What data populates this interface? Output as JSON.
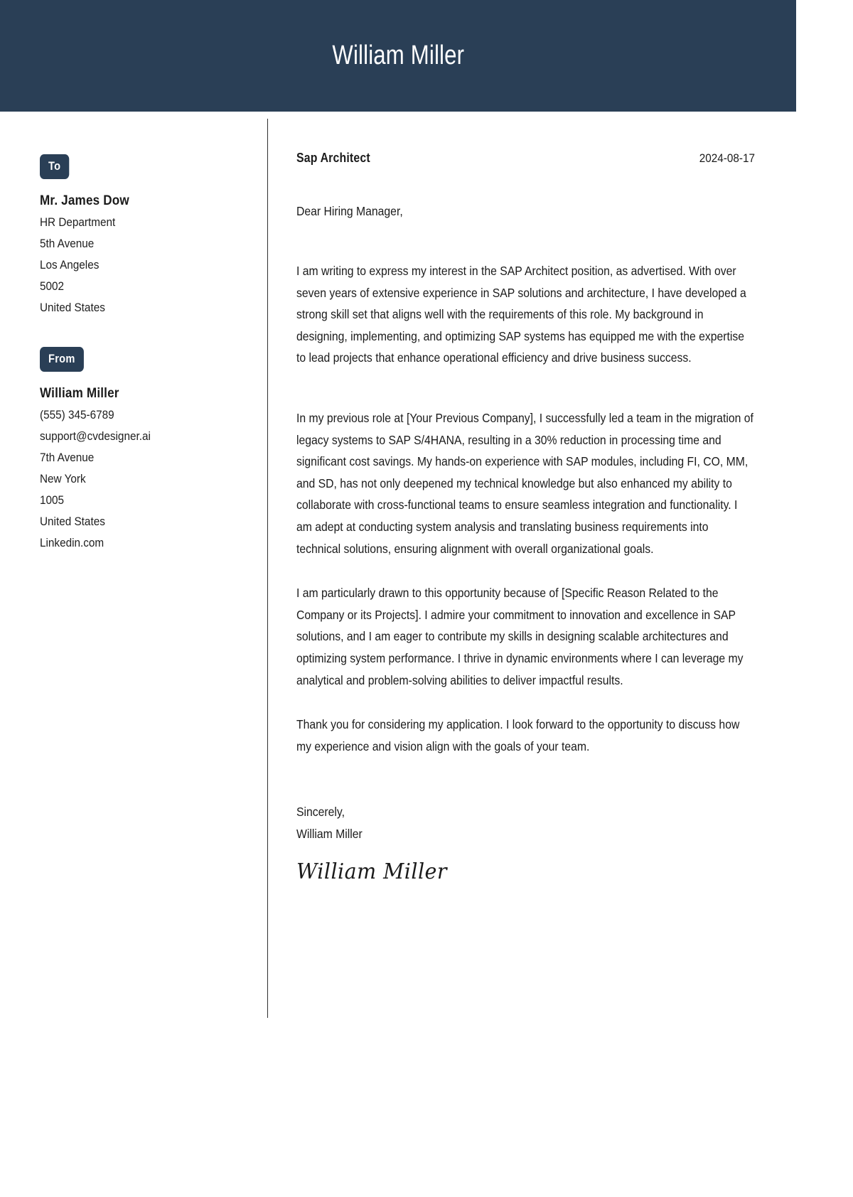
{
  "header": {
    "name": "William Miller",
    "background_color": "#2a3f56",
    "text_color": "#ffffff"
  },
  "sidebar": {
    "to": {
      "badge_label": "To",
      "name": "Mr. James Dow",
      "lines": [
        "HR Department",
        "5th Avenue",
        "Los Angeles",
        "5002",
        "United States"
      ]
    },
    "from": {
      "badge_label": "From",
      "name": "William Miller",
      "lines": [
        "(555) 345-6789",
        "support@cvdesigner.ai",
        "7th Avenue",
        "New York",
        "1005",
        "United States",
        "Linkedin.com"
      ]
    }
  },
  "letter": {
    "job_title": "Sap Architect",
    "date": "2024-08-17",
    "salutation": "Dear Hiring Manager,",
    "paragraphs": [
      "I am writing to express my interest in the SAP Architect position, as advertised. With over seven years of extensive experience in SAP solutions and architecture, I have developed a strong skill set that aligns well with the requirements of this role. My background in designing, implementing, and optimizing SAP systems has equipped me with the expertise to lead projects that enhance operational efficiency and drive business success.",
      "In my previous role at [Your Previous Company], I successfully led a team in the migration of legacy systems to SAP S/4HANA, resulting in a 30% reduction in processing time and significant cost savings. My hands-on experience with SAP modules, including FI, CO, MM, and SD, has not only deepened my technical knowledge but also enhanced my ability to collaborate with cross-functional teams to ensure seamless integration and functionality. I am adept at conducting system analysis and translating business requirements into technical solutions, ensuring alignment with overall organizational goals.",
      "I am particularly drawn to this opportunity because of [Specific Reason Related to the Company or its Projects]. I admire your commitment to innovation and excellence in SAP solutions, and I am eager to contribute my skills in designing scalable architectures and optimizing system performance. I thrive in dynamic environments where I can leverage my analytical and problem-solving abilities to deliver impactful results.",
      "Thank you for considering my application. I look forward to the opportunity to discuss how my experience and vision align with the goals of your team."
    ],
    "closing_salutation": "Sincerely,",
    "closing_name": "William Miller",
    "signature": "William Miller"
  }
}
